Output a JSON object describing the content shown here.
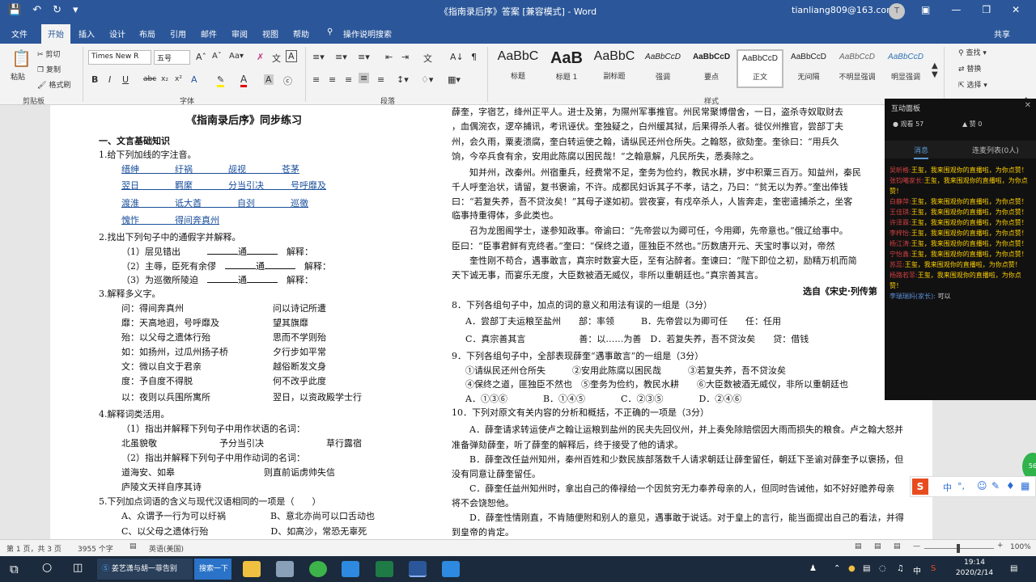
{
  "app": {
    "doc_title": "《指南录后序》答案 [兼容模式] - Word",
    "account": "tianliang809@163.com",
    "avatar_letter": "T",
    "accent": "#2b579a"
  },
  "tabs": [
    "文件",
    "开始",
    "插入",
    "设计",
    "布局",
    "引用",
    "邮件",
    "审阅",
    "视图",
    "帮助",
    "操作说明搜索"
  ],
  "share": "共享",
  "ribbon": {
    "paste": "粘贴",
    "cut": "剪切",
    "copy": "复制",
    "format_painter": "格式刷",
    "font_name": "Times New R",
    "font_size": "五号",
    "groups": {
      "clipboard": "剪贴板",
      "font": "字体",
      "paragraph": "段落",
      "styles": "样式"
    },
    "styles": [
      {
        "sample": "AaBbC",
        "name": "标题"
      },
      {
        "sample": "AaB",
        "name": "标题 1"
      },
      {
        "sample": "AaBbC",
        "name": "副标题"
      },
      {
        "sample": "AaBbCcD",
        "name": "强调"
      },
      {
        "sample": "AaBbCcD",
        "name": "要点"
      },
      {
        "sample": "AaBbCcD",
        "name": "正文"
      },
      {
        "sample": "AaBbCcD",
        "name": "无间隔"
      },
      {
        "sample": "AaBbCcD",
        "name": "不明显强调"
      },
      {
        "sample": "AaBbCcD",
        "name": "明显强调"
      }
    ],
    "find": "查找",
    "replace": "替换",
    "select": "选择"
  },
  "doc": {
    "title": "《指南录后序》同步练习",
    "left": [
      "一、文言基础知识",
      "1.给下列加线的字注音。",
      "缙绅　　　　纡祸　　　　觇视　　　　苍茅",
      "翌日　　　　羁縻　　　　分当引决　　　号呼靡及",
      "渡淮　　　　诋大酋　　　　自刭　　　　巡徼",
      "愧怍　　　　得间奔真州",
      "2.找出下列句子中的通假字并解释。",
      "（1）层见错出",
      "（2）主辱，臣死有余僇",
      "（3）为巡徼所陵迫",
      "3.解释多义字。",
      "问：得间奔真州　　　　　　　　　　问以诗记所遭",
      "靡：天高地迥，号呼靡及　　　　　　望其旗靡",
      "殆：以父母之遗体行殆　　　　　　　思而不学则殆",
      "如：如扬州，过瓜州扬子桥　　　　　夕行步如平常",
      "文：微以自文于君亲　　　　　　　　越俗断发文身",
      "度：予自度不得脱　　　　　　　　　何不改乎此度",
      "以：夜则以兵围所寓所　　　　　　　翌日，以资政殿学士行",
      "4.解释词类活用。",
      "（1）指出并解释下列句子中用作状语的名词：",
      "北虽貌敬　　　　　　　予分当引决　　　　　　　草行露宿",
      "（2）指出并解释下列句子中用作动词的名词：",
      "道海安、如皋　　　　　　　　　　则直前诟虏帅失信",
      "庐陵文天祥自序其诗",
      "5.下列加点词语的含义与现代汉语相同的一项是（　　）",
      "A、众谓予一行为可以纡祸　　　　　B、意北亦尚可以口舌动也",
      "C、以父母之遗体行殆　　　　　　　D、如高沙，常恐无辜死"
    ],
    "right": [
      "薛奎，字宿艺，绛州正平人。进士及第，为隰州军事推官。州民常聚博僧舍，一日，盗杀寺奴取财去",
      "，血偶涴衣，逻卒捕讯，考讯诬伏。奎独疑之，白州缓其狱，后果得杀人者。徙仪州推官，尝部丁夫",
      "州，会久雨，粟麦溃腐，奎白转运使之翰，请纵民还州仓所失。之翰怒，欲劾奎。奎徐曰：“用兵久",
      "饷，今卒兵食有余，安用此陈腐以困民哉！”之翰意解，凡民所失，悉奏除之。",
      "知并州，改秦州。州宿重兵，经费常不足，奎务为俭约，教民水耕，岁中积粟三百万。知益州，秦民",
      "千人呼奎治状，请留，复书褒谕，不许。成都民妇诉其子不孝，诘之，乃曰：“贫无以为养。”奎出俸钱",
      "曰：“若复失养，吾不贷汝矣！”其母子遂如初。尝夜宴，有戍卒杀人，人皆奔走，奎密遣捕杀之，坐客",
      "临事持重得体，多此类也。",
      "召为龙图阁学士，遂参知政事。帝谕曰：“先帝尝以为卿可任，今用卿，先帝意也。”俄辽给事中。",
      "臣曰：“臣事君鲜有克终者。”奎曰：“保终之道，匪独臣不然也。”历数唐开元、天宝时事以对，帝然",
      "奎性刚不苟合，遇事敢言，真宗时数宴大臣，至有沾醉者。奎谏曰：“陛下即位之初，励精万机而简",
      "天下诚无事，而宴乐无度，大臣数被酒无威仪，非所以重朝廷也。”真宗善其言。",
      "选自《宋史·列传第",
      "8．下列各组句子中，加点的词的意义和用法有误的一组是（3分）",
      "A．尝部丁夫运粮至盐州　　部：率领　　　B．先帝尝以为卿可任　　任：任用",
      "C．真宗善其言　　　　　　善：以……为善　D．若复失养，吾不贷汝矣　　贷：借钱",
      "9．下列各组句子中，全部表现薛奎“遇事敢言”的一组是（3分）",
      "①请纵民还州仓所失　　　②安用此陈腐以困民哉　　　③若复失养，吾不贷汝矣",
      "④保终之道，匪独臣不然也　⑤奎务为俭约，教民水耕　　⑥大臣数被酒无威仪，非所以重朝廷也",
      "A．①③⑥　　　　B．①④⑤　　　　C．②③⑤　　　　D．②④⑥",
      "10．下列对原文有关内容的分析和概括，不正确的一项是（3分）",
      "A．薛奎请求转运使卢之翰让运粮到盐州的民夫先回仪州，并上奏免除赔偿因大雨而损失的粮食。卢之翰大怒并",
      "准备弹劾薛奎，听了薛奎的解释后，终于接受了他的请求。",
      "B．薛奎改任益州知州，秦州百姓和少数民族部落数千人请求朝廷让薛奎留任，朝廷下圣谕对薛奎予以褒扬，但",
      "没有同意让薛奎留任。",
      "C．薛奎任益州知州时，拿出自己的俸禄给一个因贫穷无力奉养母亲的人，但同时告诫他，如不好好赡养母亲",
      "将不会饶恕他。",
      "D．薛奎性情刚直，不肯随便附和别人的意见，遇事敢于说话。对于皇上的言行，能当面提出自己的看法，并得",
      "到皇帝的肯定。"
    ]
  },
  "blank_mid": "通",
  "blank_tail": "解释：",
  "panel": {
    "title": "互动面板",
    "viewers": "观看 57",
    "likes": "赞 0",
    "tab_msgs": "消息",
    "tab_mic": "连麦列表(0人)",
    "messages": [
      {
        "n": "吴昕格:",
        "t": "王玺，我来围观你的直播啦，为你点赞！"
      },
      {
        "n": "张钧曦家长:",
        "t": "王玺，我来围观你的直播啦，为你点赞！"
      },
      {
        "n": "白静萍:",
        "t": "王玺，我来围观你的直播啦，为你点赞！"
      },
      {
        "n": "王佳琪:",
        "t": "王玺，我来围观你的直播啦，为你点赞！"
      },
      {
        "n": "许泽霖:",
        "t": "王玺，我来围观你的直播啦，为你点赞！"
      },
      {
        "n": "李梓怡:",
        "t": "王玺，我来围观你的直播啦，为你点赞！"
      },
      {
        "n": "杨江涛:",
        "t": "王玺，我来围观你的直播啦，为你点赞！"
      },
      {
        "n": "宁怡鑫:",
        "t": "王玺，我来围观你的直播啦，为你点赞！"
      },
      {
        "n": "苏蕊:",
        "t": "王玺，我来围观你的直播啦，为你点赞！"
      },
      {
        "n": "杨路若菲:",
        "t": "王玺，我来围观你的直播啦，为你点赞！"
      },
      {
        "n": "李瑞瑞妈(家长):",
        "t": "可以"
      }
    ]
  },
  "status": {
    "page": "第 1 页，共 3 页",
    "words": "3955 个字",
    "lang": "英语(美国)",
    "zoom": "100%"
  },
  "taskbar": {
    "app1": "姜艺潇与胡一菲告别",
    "app2": "搜索一下",
    "time": "19:14",
    "date": "2020/2/14",
    "ime": "中"
  }
}
